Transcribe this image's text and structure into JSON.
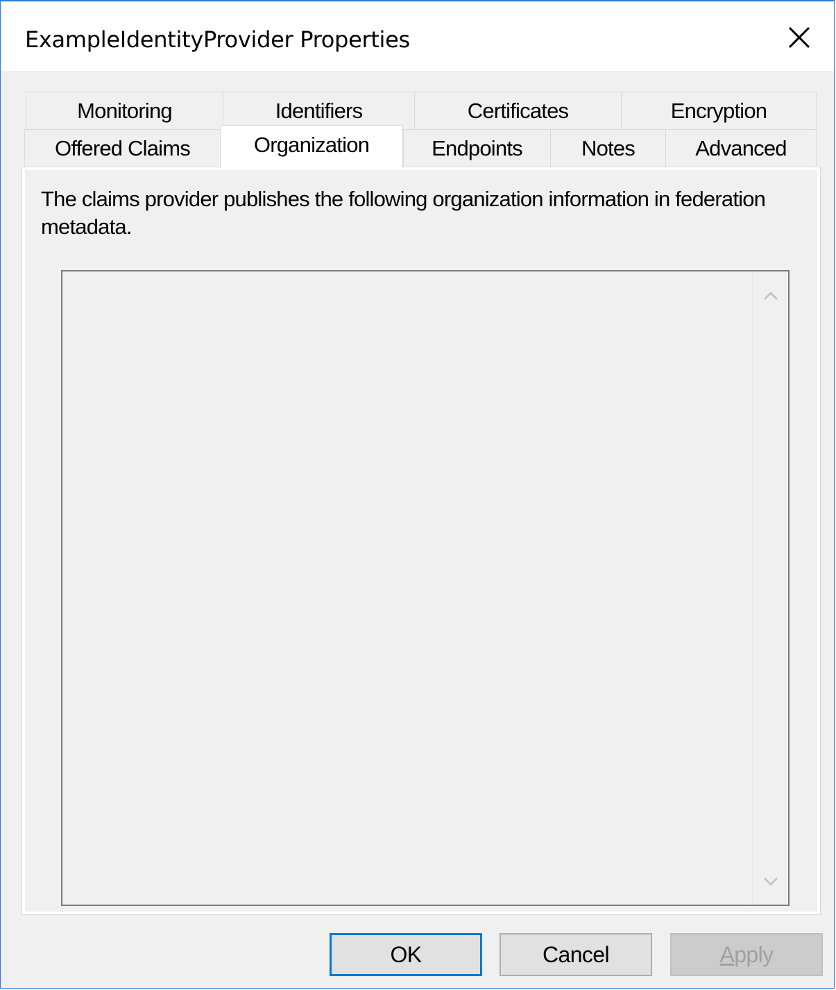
{
  "window": {
    "title": "ExampleIdentityProvider Properties",
    "close_icon": "close-icon"
  },
  "tabs": {
    "back_row": [
      {
        "label": "Monitoring"
      },
      {
        "label": "Identifiers"
      },
      {
        "label": "Certificates"
      },
      {
        "label": "Encryption"
      }
    ],
    "front_row": [
      {
        "label": "Offered Claims"
      },
      {
        "label": "Organization",
        "selected": true
      },
      {
        "label": "Endpoints"
      },
      {
        "label": "Notes"
      },
      {
        "label": "Advanced"
      }
    ]
  },
  "panel": {
    "description": "The claims provider publishes the following organization information in federation metadata.",
    "organization_text": ""
  },
  "buttons": {
    "ok": "OK",
    "cancel": "Cancel",
    "apply": "Apply",
    "apply_enabled": false
  },
  "colors": {
    "accent": "#0078d7",
    "window_border": "#2b79d6",
    "dialog_background": "#f0f0f0"
  }
}
